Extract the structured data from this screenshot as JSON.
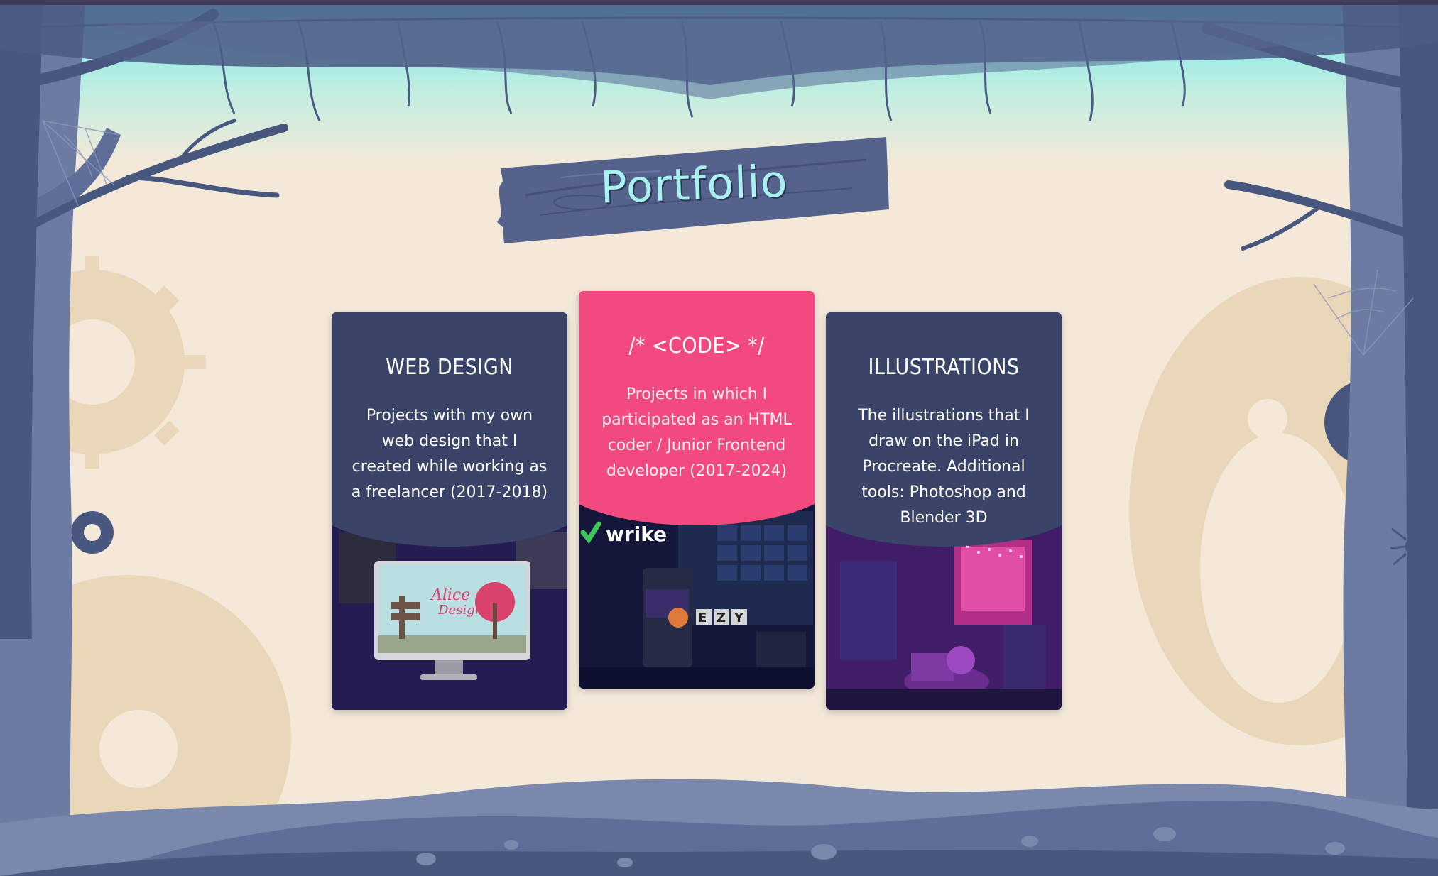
{
  "page": {
    "title": "Portfolio"
  },
  "cards": [
    {
      "title": "WEB DESIGN",
      "description": "Projects with my own web design that I created while working as a freelancer (2017-2018)",
      "image_text": "Alice Design",
      "color": "#3a4468"
    },
    {
      "title": "/* <CODE> */",
      "description": "Projects in which I participated as an HTML coder / Junior Frontend developer (2017-2024)",
      "image_brand": "wrike",
      "image_logo": "EZY",
      "color": "#f24a7e"
    },
    {
      "title": "ILLUSTRATIONS",
      "description": "The illustrations that I draw on the iPad in Procreate. Additional tools: Photoshop and Blender 3D",
      "color": "#3a4468"
    }
  ],
  "colors": {
    "background": "#f4e9d9",
    "sky": "#7ee6ee",
    "forest": "#5f6e98",
    "forest_dark": "#48577e",
    "gear": "#ead6b8",
    "title_text": "#a9f1ee",
    "plank": "#55628c"
  },
  "icons": [
    "gear-icon",
    "tree-icon",
    "spiderweb-icon",
    "spider-icon"
  ]
}
